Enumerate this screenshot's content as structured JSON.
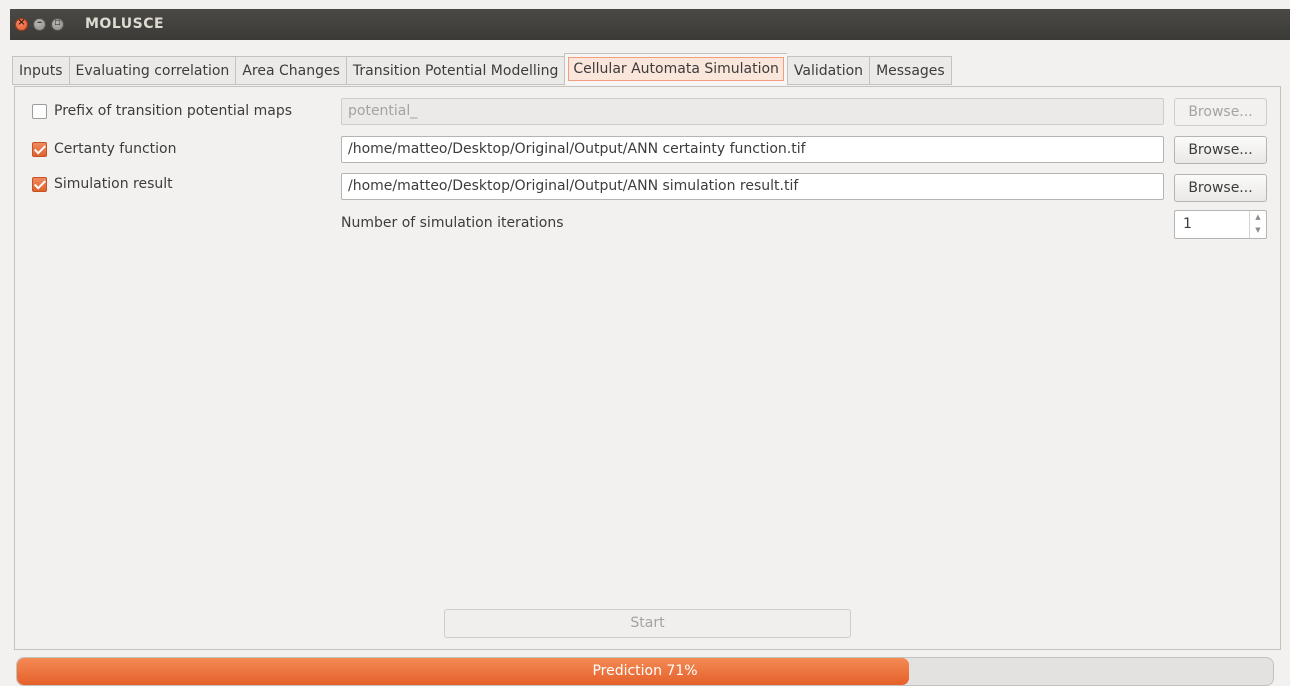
{
  "window": {
    "title": "MOLUSCE",
    "close_glyph": "×",
    "minimize_glyph": "–",
    "maximize_glyph": "▫"
  },
  "tabs": [
    {
      "label": "Inputs",
      "active": false
    },
    {
      "label": "Evaluating correlation",
      "active": false
    },
    {
      "label": "Area Changes",
      "active": false
    },
    {
      "label": "Transition Potential Modelling",
      "active": false
    },
    {
      "label": "Cellular Automata Simulation",
      "active": true
    },
    {
      "label": "Validation",
      "active": false
    },
    {
      "label": "Messages",
      "active": false
    }
  ],
  "form": {
    "prefix": {
      "label": "Prefix of transition potential maps",
      "checked": false,
      "value": "potential_",
      "enabled": false,
      "browse_label": "Browse..."
    },
    "certainty": {
      "label": "Certanty function",
      "checked": true,
      "value": "/home/matteo/Desktop/Original/Output/ANN certainty function.tif",
      "browse_label": "Browse..."
    },
    "simulation": {
      "label": "Simulation result",
      "checked": true,
      "value": "/home/matteo/Desktop/Original/Output/ANN simulation result.tif",
      "browse_label": "Browse..."
    },
    "iterations": {
      "label": "Number of simulation iterations",
      "value": "1",
      "up_glyph": "▲",
      "down_glyph": "▼"
    }
  },
  "start_label": "Start",
  "progress": {
    "text": "Prediction 71%",
    "percent": 71
  },
  "colors": {
    "accent": "#e5602a",
    "titlebar": "#3b3a36"
  }
}
